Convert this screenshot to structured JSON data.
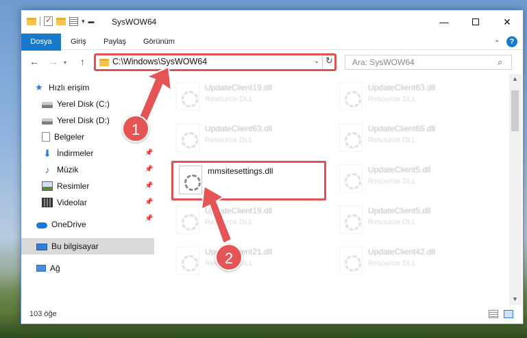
{
  "window": {
    "title": "SysWOW64"
  },
  "ribbon": {
    "tabs": [
      "Dosya",
      "Giriş",
      "Paylaş",
      "Görünüm"
    ],
    "help": "?"
  },
  "address": {
    "path": "C:\\Windows\\SysWOW64",
    "search_placeholder": "Ara: SysWOW64"
  },
  "sidebar": {
    "items": [
      {
        "label": "Hızlı erişim",
        "icon": "star-icon"
      },
      {
        "label": "Yerel Disk (C:)",
        "icon": "disk-icon"
      },
      {
        "label": "Yerel Disk (D:)",
        "icon": "disk-icon"
      },
      {
        "label": "Belgeler",
        "icon": "document-icon"
      },
      {
        "label": "İndirmeler",
        "icon": "download-icon"
      },
      {
        "label": "Müzik",
        "icon": "music-icon"
      },
      {
        "label": "Resimler",
        "icon": "pictures-icon"
      },
      {
        "label": "Videolar",
        "icon": "video-icon"
      },
      {
        "label": "OneDrive",
        "icon": "cloud-icon"
      },
      {
        "label": "Bu bilgisayar",
        "icon": "computer-icon"
      },
      {
        "label": "Ağ",
        "icon": "network-icon"
      }
    ]
  },
  "files": [
    {
      "name": "UpdateClient19.dll",
      "type": "Resource DLL"
    },
    {
      "name": "UpdateClient63.dll",
      "type": "Resource DLL"
    },
    {
      "name": "UpdateClient63.dll",
      "type": "Resource DLL"
    },
    {
      "name": "UpdateClient65.dll",
      "type": "Resource DLL"
    },
    {
      "name": "mmsitesettings.dll",
      "type": ""
    },
    {
      "name": "UpdateClient5.dll",
      "type": "Resource DLL"
    },
    {
      "name": "UpdateClient19.dll",
      "type": "Resource DLL"
    },
    {
      "name": "UpdateClient5.dll",
      "type": "Resource DLL"
    },
    {
      "name": "UpdateClient21.dll",
      "type": "Resource DLL"
    },
    {
      "name": "UpdateClient42.dll",
      "type": "Resource DLL"
    }
  ],
  "badges": {
    "one": "1",
    "two": "2"
  },
  "status": {
    "count": "103 öğe"
  }
}
